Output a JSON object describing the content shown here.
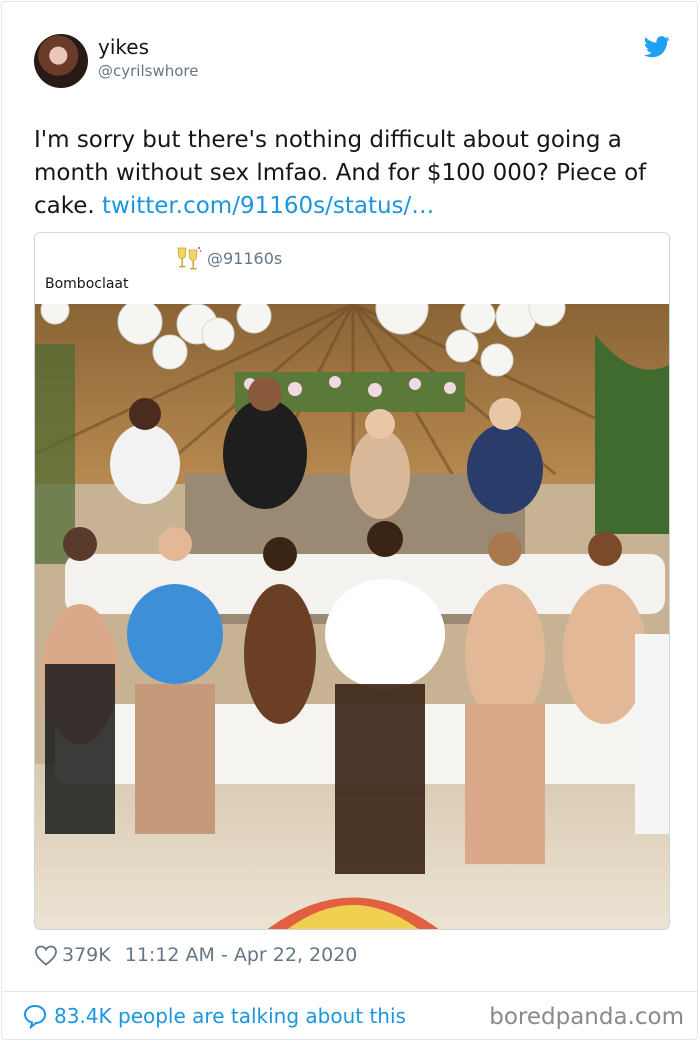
{
  "tweet": {
    "display_name": "yikes",
    "handle": "@cyrilswhore",
    "text_main": "I'm sorry but there's nothing difficult about going a month without sex lmfao. And for $100 000? Piece of cake.",
    "link_text": "twitter.com/91160s/status/…",
    "likes": "379K",
    "timestamp": "11:12 AM - Apr 22, 2020",
    "talking": "83.4K people are talking about this"
  },
  "quote": {
    "handle": "@91160s",
    "name": "Bomboclaat",
    "emoji": "clinking-glasses-icon"
  },
  "icons": {
    "twitter": "twitter-bird-icon",
    "heart": "heart-icon",
    "bubble": "speech-bubble-icon"
  },
  "colors": {
    "link": "#1b95e0",
    "twitter_blue": "#1da1f2",
    "muted": "#657786",
    "text": "#14171a"
  },
  "watermark": "boredpanda.com"
}
